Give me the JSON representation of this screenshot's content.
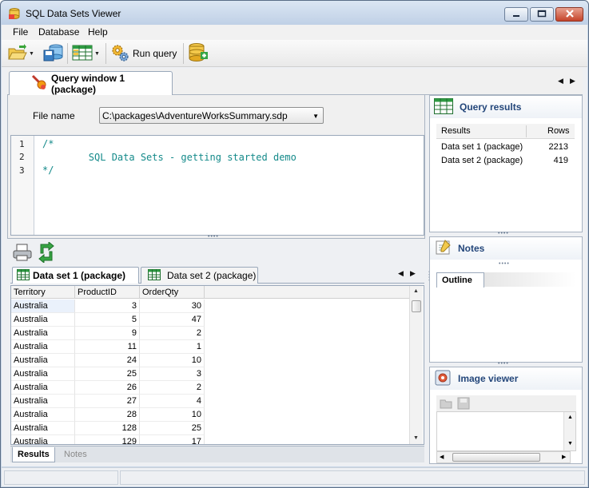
{
  "window": {
    "title": "SQL Data Sets Viewer"
  },
  "menu": {
    "items": [
      "File",
      "Database",
      "Help"
    ]
  },
  "toolbar": {
    "run_query_label": "Run query"
  },
  "document_tab": {
    "label": "Query window 1 (package)"
  },
  "query_window": {
    "file_name_label": "File name",
    "file_path": "C:\\packages\\AdventureWorksSummary.sdp",
    "line_numbers": [
      "1",
      "2",
      "3"
    ],
    "code_lines": [
      "/*",
      "        SQL Data Sets - getting started demo",
      "*/"
    ]
  },
  "dataset_tabs": [
    "Data set 1 (package)",
    "Data set 2 (package)"
  ],
  "grid": {
    "columns": [
      "Territory",
      "ProductID",
      "OrderQty"
    ],
    "rows": [
      [
        "Australia",
        "3",
        "30"
      ],
      [
        "Australia",
        "5",
        "47"
      ],
      [
        "Australia",
        "9",
        "2"
      ],
      [
        "Australia",
        "11",
        "1"
      ],
      [
        "Australia",
        "24",
        "10"
      ],
      [
        "Australia",
        "25",
        "3"
      ],
      [
        "Australia",
        "26",
        "2"
      ],
      [
        "Australia",
        "27",
        "4"
      ],
      [
        "Australia",
        "28",
        "10"
      ],
      [
        "Australia",
        "128",
        "25"
      ],
      [
        "Australia",
        "129",
        "17"
      ]
    ]
  },
  "bottom_tabs": [
    "Results",
    "Notes"
  ],
  "query_results": {
    "title": "Query results",
    "columns": [
      "Results",
      "Rows"
    ],
    "rows": [
      [
        "Data set 1 (package)",
        "2213"
      ],
      [
        "Data set 2 (package)",
        "419"
      ]
    ]
  },
  "notes_panel": {
    "title": "Notes",
    "tab_label": "Outline"
  },
  "image_viewer": {
    "title": "Image viewer"
  },
  "colors": {
    "panel_title": "#23467a",
    "code_text": "#148a8a"
  }
}
